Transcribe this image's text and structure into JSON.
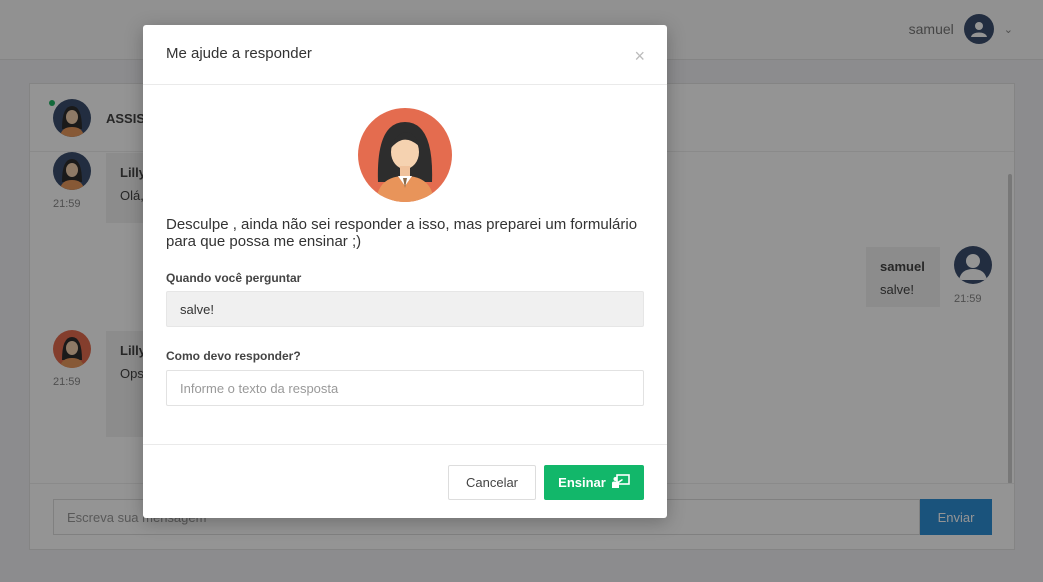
{
  "header": {
    "user_name": "samuel",
    "user_icon": "user-avatar-icon",
    "menu_icon": "chevron-down-icon"
  },
  "chat": {
    "title": "ASSIS",
    "status_color": "#1fb566",
    "messages": [
      {
        "sender": "Lilly",
        "text": "Olá,",
        "time": "21:59",
        "from": "bot"
      },
      {
        "sender": "samuel",
        "text": "salve!",
        "time": "21:59",
        "from": "user"
      },
      {
        "sender": "Lilly",
        "text": "Ops",
        "time": "21:59",
        "from": "bot"
      }
    ],
    "input_placeholder": "Escreva sua mensagem",
    "send_label": "Enviar"
  },
  "modal": {
    "title": "Me ajude a responder",
    "close_symbol": "×",
    "intro": "Desculpe , ainda não sei responder a isso, mas preparei um formulário para que possa me ensinar ;)",
    "question_label": "Quando você perguntar",
    "question_value": "salve!",
    "answer_label": "Como devo responder?",
    "answer_placeholder": "Informe o texto da resposta",
    "cancel_label": "Cancelar",
    "teach_label": "Ensinar",
    "teach_icon": "teach-board-icon"
  },
  "colors": {
    "primary_green": "#12b76a",
    "send_blue": "#2e8fd6",
    "bot_avatar_bg": "#e46c4f"
  }
}
